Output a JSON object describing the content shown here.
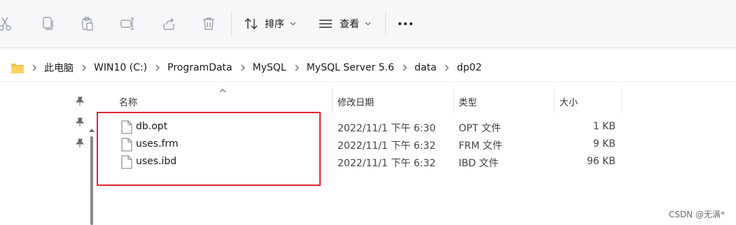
{
  "toolbar": {
    "icons": [
      "cut-icon",
      "copy-icon",
      "paste-icon",
      "rename-icon",
      "share-icon",
      "delete-icon"
    ],
    "sort_label": "排序",
    "view_label": "查看",
    "more_label": "•••"
  },
  "address": {
    "crumbs": [
      "此电脑",
      "WIN10 (C:)",
      "ProgramData",
      "MySQL",
      "MySQL Server 5.6",
      "data",
      "dp02"
    ]
  },
  "columns": {
    "name": "名称",
    "date": "修改日期",
    "type": "类型",
    "size": "大小"
  },
  "files": [
    {
      "name": "db.opt",
      "date": "2022/11/1 下午 6:30",
      "type": "OPT 文件",
      "size": "1 KB"
    },
    {
      "name": "uses.frm",
      "date": "2022/11/1 下午 6:32",
      "type": "FRM 文件",
      "size": "9 KB"
    },
    {
      "name": "uses.ibd",
      "date": "2022/11/1 下午 6:32",
      "type": "IBD 文件",
      "size": "96 KB"
    }
  ],
  "watermark": "CSDN @无满*",
  "colors": {
    "highlight": "#e0282f",
    "folder": "#f5c242"
  }
}
